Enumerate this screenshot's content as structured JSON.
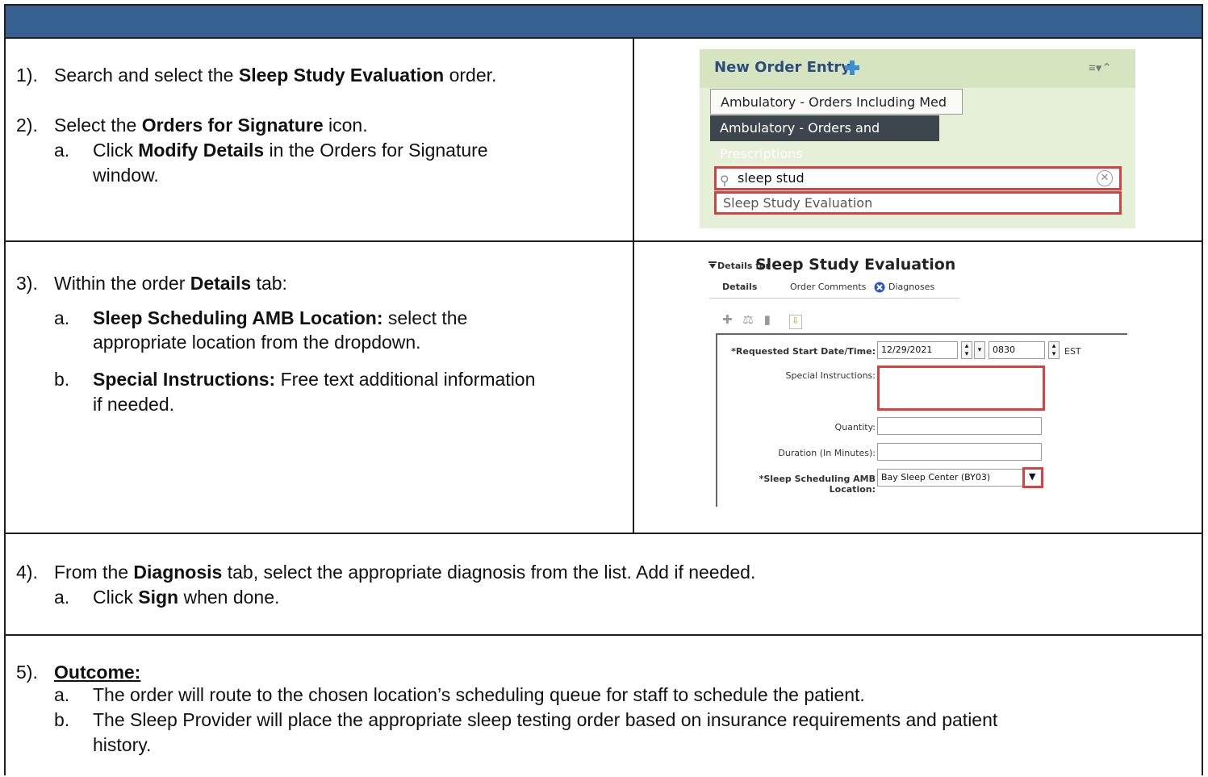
{
  "steps": {
    "s1": {
      "num": "1).",
      "pre": "Search and select the ",
      "bold": "Sleep Study Evaluation",
      "post": " order."
    },
    "s2": {
      "num": "2).",
      "pre": "Select the ",
      "bold": "Orders for Signature",
      "post": " icon.",
      "a_letter": "a.",
      "a_pre": "Click ",
      "a_bold": "Modify Details",
      "a_post": " in the Orders for Signature",
      "a_line2": "window."
    },
    "s3": {
      "num": "3).",
      "pre": "Within the order ",
      "bold": "Details",
      "post": " tab:",
      "a_letter": "a.",
      "a_bold": "Sleep Scheduling AMB Location:",
      "a_post": " select the",
      "a_line2": "appropriate location from the dropdown.",
      "b_letter": "b.",
      "b_bold": "Special Instructions:",
      "b_post": " Free text additional information",
      "b_line2": "if needed."
    },
    "s4": {
      "num": "4).",
      "pre": "From the ",
      "bold": "Diagnosis",
      "post": " tab, select the appropriate diagnosis from the list.  Add if needed.",
      "a_letter": "a.",
      "a_pre": "Click ",
      "a_bold": "Sign",
      "a_post": " when done."
    },
    "s5": {
      "num": "5).",
      "bold": "Outcome:",
      "a_letter": "a.",
      "a_text": "The order will route to the chosen location’s scheduling queue for staff to schedule the patient.",
      "b_letter": "b.",
      "b_text": "The Sleep Provider will place the appropriate sleep testing order based on insurance requirements and patient",
      "b_line2": "history."
    }
  },
  "shot1": {
    "title": "New Order Entry",
    "folder1": "Ambulatory - Orders Including Med Admin",
    "folder2": "Ambulatory - Orders and Prescriptions",
    "search_value": "sleep stud",
    "result": "Sleep Study Evaluation",
    "clear_glyph": "✕",
    "menu_glyph": "≡▾⌃"
  },
  "shot2": {
    "details_for": "Details for",
    "title": "Sleep Study Evaluation",
    "tabs": [
      "Details",
      "Order Comments",
      "Diagnoses"
    ],
    "fields": {
      "start_label": "*Requested Start Date/Time:",
      "start_date": "12/29/2021",
      "start_time": "0830",
      "tz": "EST",
      "special_label": "Special Instructions:",
      "quantity_label": "Quantity:",
      "duration_label": "Duration (In Minutes):",
      "location_label": "*Sleep Scheduling AMB Location:",
      "location_value": "Bay Sleep Center (BY03)"
    }
  },
  "colors": {
    "header": "#35608f",
    "highlight": "#d94040",
    "panel": "#e6efd7",
    "dark_button": "#3d464d"
  }
}
